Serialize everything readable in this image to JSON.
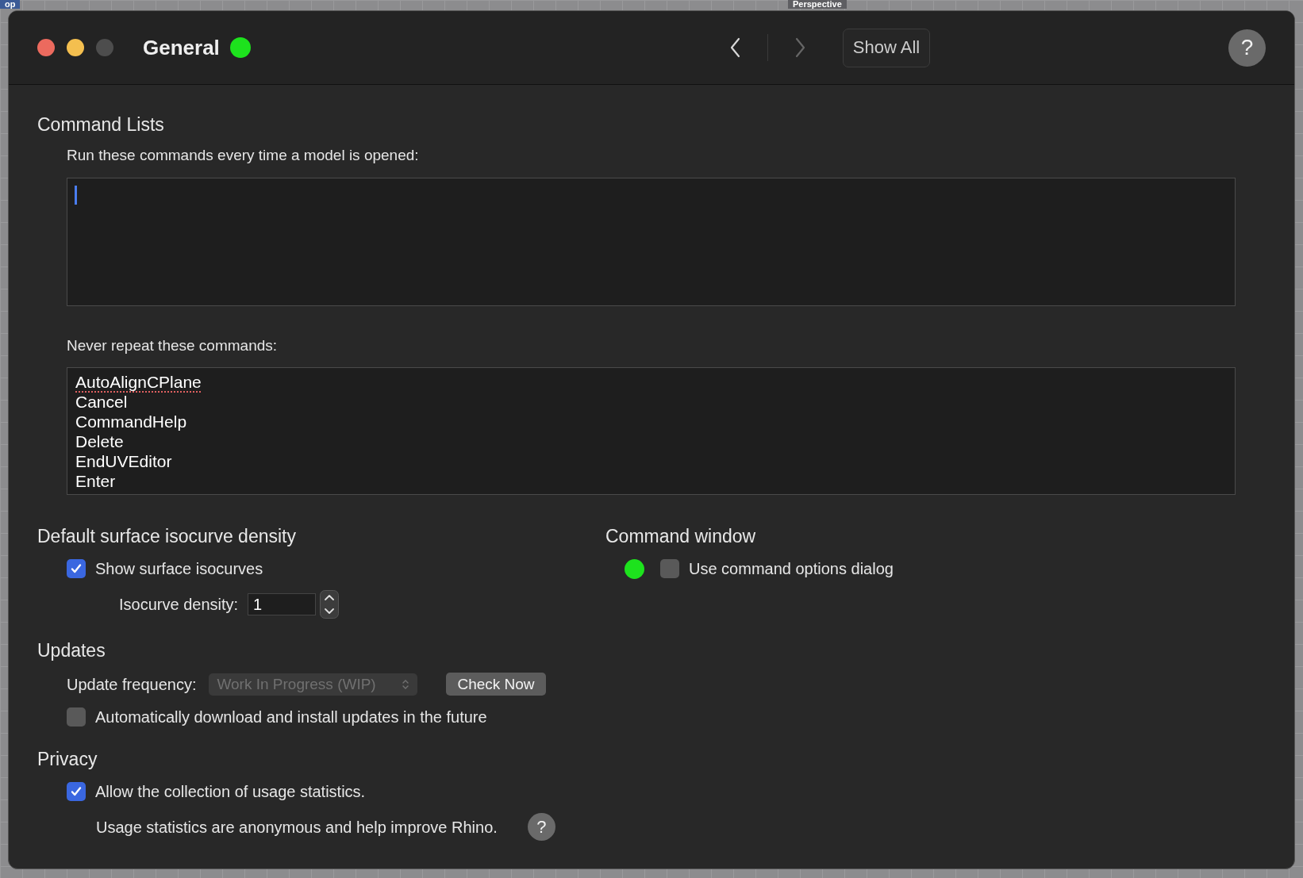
{
  "viewport_tabs": [
    {
      "label": "op"
    },
    {
      "label": "Perspective"
    }
  ],
  "window": {
    "title": "General",
    "status_on": true,
    "show_all": "Show All",
    "back_enabled": true,
    "forward_enabled": false
  },
  "command_lists": {
    "heading": "Command Lists",
    "run_label": "Run these commands every time a model is opened:",
    "never_label": "Never repeat these commands:",
    "never_items": [
      {
        "text": "AutoAlignCPlane",
        "misspelled": true
      },
      {
        "text": "Cancel",
        "misspelled": false
      },
      {
        "text": "CommandHelp",
        "misspelled": false
      },
      {
        "text": "Delete",
        "misspelled": false
      },
      {
        "text": "EndUVEditor",
        "misspelled": false
      },
      {
        "text": "Enter",
        "misspelled": false
      }
    ]
  },
  "isocurves": {
    "heading": "Default surface isocurve density",
    "show_label": "Show surface isocurves",
    "show_checked": true,
    "density_label": "Isocurve density:",
    "density_value": "1"
  },
  "command_window": {
    "heading": "Command window",
    "dot_on": true,
    "label": "Use command options dialog",
    "checked": false
  },
  "updates": {
    "heading": "Updates",
    "frequency_label": "Update frequency:",
    "frequency_value": "Work In Progress (WIP)",
    "frequency_disabled": true,
    "check_now": "Check Now",
    "auto_label": "Automatically download and install updates in the future",
    "auto_checked": false
  },
  "privacy": {
    "heading": "Privacy",
    "allow_label": "Allow the collection of usage statistics.",
    "allow_checked": true,
    "note": "Usage statistics are anonymous and help improve Rhino.",
    "help": "?"
  },
  "help": "?"
}
